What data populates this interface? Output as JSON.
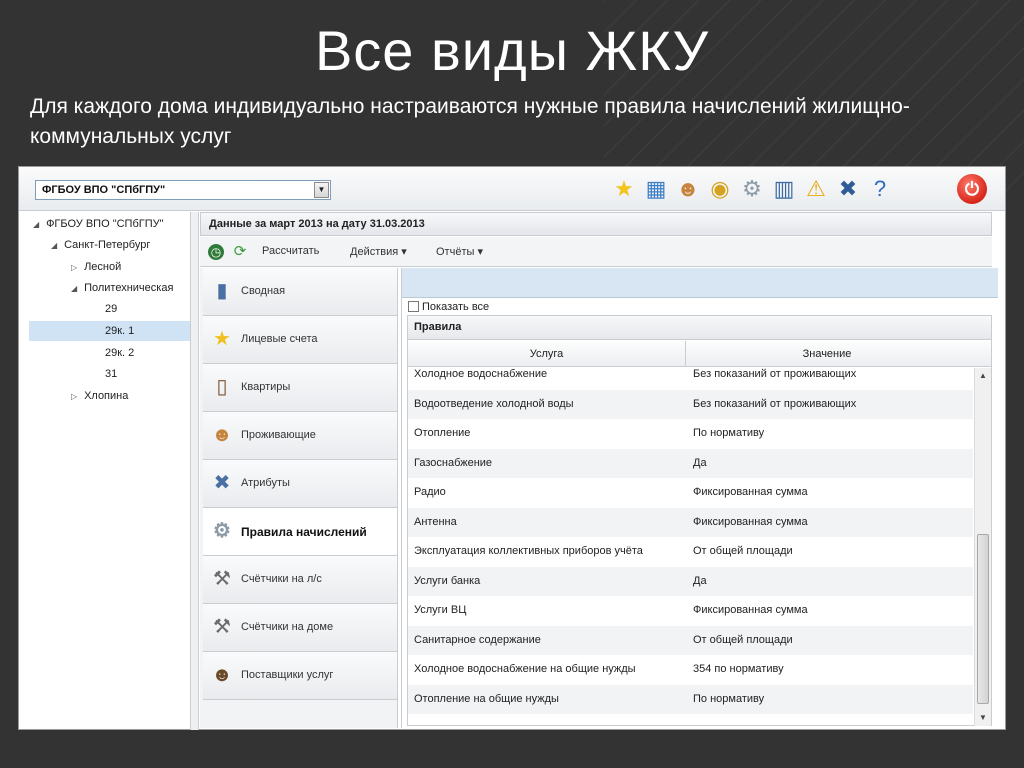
{
  "slide": {
    "title": "Все виды ЖКУ",
    "subtitle": "Для каждого дома индивидуально настраиваются нужные правила начислений жилищно-коммунальных услуг"
  },
  "app": {
    "org_select_value": "ФГБОУ ВПО \"СПбГПУ\"",
    "toolbar_icons": [
      "star-icon",
      "building-icon",
      "users-icon",
      "coins-icon",
      "magnifier-gear-icon",
      "city-icon",
      "warning-icon",
      "tools-icon",
      "help-icon",
      "power-icon"
    ],
    "tree": {
      "root": "ФГБОУ ВПО \"СПбГПУ\"",
      "city": "Санкт-Петербург",
      "district1": "Лесной",
      "district2": "Политехническая",
      "houses": [
        "29",
        "29к. 1",
        "29к. 2",
        "31"
      ],
      "district3": "Хлопина"
    },
    "period_header": "Данные за март 2013 на дату 31.03.2013",
    "actions": {
      "calculate": "Рассчитать",
      "actions": "Действия",
      "reports": "Отчёты"
    },
    "nav": [
      "Сводная",
      "Лицевые счета",
      "Квартиры",
      "Проживающие",
      "Атрибуты",
      "Правила начислений",
      "Счётчики на л/с",
      "Счётчики на доме",
      "Поставщики услуг"
    ],
    "show_all": "Показать все",
    "rules": {
      "title": "Правила",
      "columns": [
        "Услуга",
        "Значение"
      ],
      "rows": [
        [
          "Холодное водоснабжение",
          "Без показаний от проживающих"
        ],
        [
          "Водоотведение холодной воды",
          "Без показаний от проживающих"
        ],
        [
          "Отопление",
          "По нормативу"
        ],
        [
          "Газоснабжение",
          "Да"
        ],
        [
          "Радио",
          "Фиксированная сумма"
        ],
        [
          "Антенна",
          "Фиксированная сумма"
        ],
        [
          "Эксплуатация коллективных приборов учёта",
          "От общей площади"
        ],
        [
          "Услуги банка",
          "Да"
        ],
        [
          "Услуги ВЦ",
          "Фиксированная сумма"
        ],
        [
          "Санитарное содержание",
          "От общей площади"
        ],
        [
          "Холодное водоснабжение на общие нужды",
          "354 по нормативу"
        ],
        [
          "Отопление на общие нужды",
          "По нормативу"
        ]
      ]
    }
  }
}
